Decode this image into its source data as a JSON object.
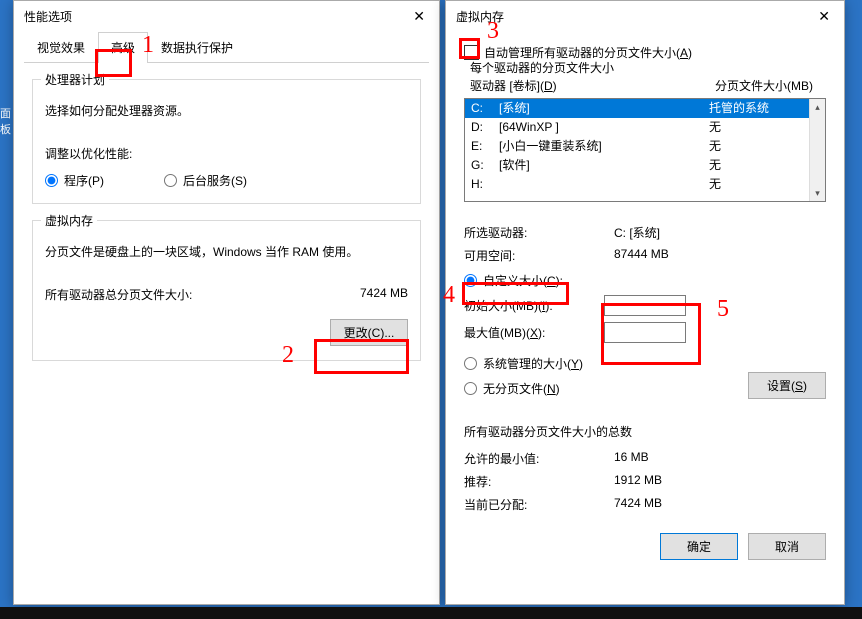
{
  "left": {
    "title": "性能选项",
    "tabs": {
      "visual": "视觉效果",
      "advanced": "高级",
      "dep": "数据执行保护"
    },
    "proc": {
      "group": "处理器计划",
      "desc": "选择如何分配处理器资源。",
      "adjust": "调整以优化性能:",
      "programs": "程序(P)",
      "bg": "后台服务(S)"
    },
    "vm": {
      "group": "虚拟内存",
      "desc": "分页文件是硬盘上的一块区域，Windows 当作 RAM 使用。",
      "total_label": "所有驱动器总分页文件大小:",
      "total_value": "7424 MB",
      "change_btn": "更改(C)..."
    }
  },
  "right": {
    "title": "虚拟内存",
    "auto_manage_pre": "自动管理所有驱动器的分页文件大小(",
    "auto_manage_post": ")",
    "auto_manage_key": "A",
    "per_drive": "每个驱动器的分页文件大小",
    "drive_col_pre": "驱动器 [卷标](",
    "drive_col_post": ")",
    "drive_col_key": "D",
    "paging_col": "分页文件大小(MB)",
    "drives": [
      {
        "d": "C:",
        "label": "[系统]",
        "size": "托管的系统",
        "sel": true
      },
      {
        "d": "D:",
        "label": "[64WinXP ]",
        "size": "无",
        "sel": false
      },
      {
        "d": "E:",
        "label": "[小白一键重装系统]",
        "size": "无",
        "sel": false
      },
      {
        "d": "G:",
        "label": "[软件]",
        "size": "无",
        "sel": false
      },
      {
        "d": "H:",
        "label": "",
        "size": "无",
        "sel": false
      }
    ],
    "sel_drive_label": "所选驱动器:",
    "sel_drive_value": "C:  [系统]",
    "avail_label": "可用空间:",
    "avail_value": "87444 MB",
    "custom_pre": "自定义大小(",
    "custom_post": "):",
    "custom_key": "C",
    "init_pre": "初始大小(MB)(",
    "init_post": "):",
    "init_key": "I",
    "max_pre": "最大值(MB)(",
    "max_post": "):",
    "max_key": "X",
    "system_pre": "系统管理的大小(",
    "system_post": ")",
    "system_key": "Y",
    "none_pre": "无分页文件(",
    "none_post": ")",
    "none_key": "N",
    "set_pre": "设置(",
    "set_post": ")",
    "set_key": "S",
    "totals_title": "所有驱动器分页文件大小的总数",
    "min_label": "允许的最小值:",
    "min_value": "16 MB",
    "rec_label": "推荐:",
    "rec_value": "1912 MB",
    "cur_label": "当前已分配:",
    "cur_value": "7424 MB",
    "ok": "确定",
    "cancel": "取消"
  },
  "anno": {
    "n1": "1",
    "n2": "2",
    "n3": "3",
    "n4": "4",
    "n5": "5"
  },
  "desktop_icon_label": "面板",
  "arrows": {
    "up": "▴",
    "down": "▾"
  }
}
